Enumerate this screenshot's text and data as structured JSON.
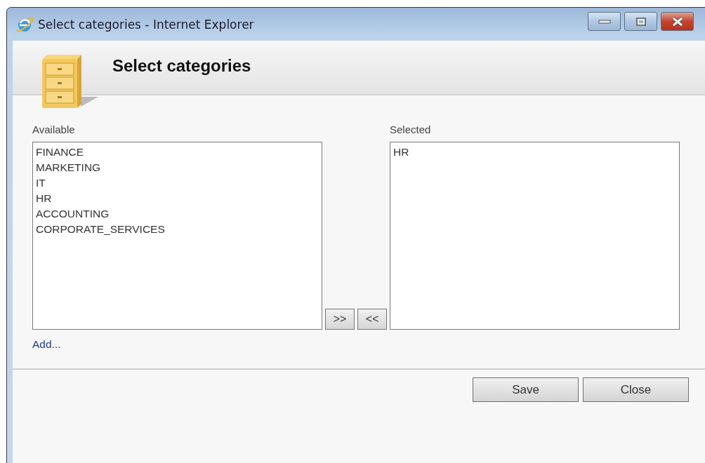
{
  "window": {
    "title": "Select categories - Internet Explorer"
  },
  "header": {
    "title": "Select categories"
  },
  "available": {
    "label": "Available",
    "items": [
      "FINANCE",
      "MARKETING",
      "IT",
      "HR",
      "ACCOUNTING",
      "CORPORATE_SERVICES"
    ]
  },
  "move_buttons": [
    ">>",
    "<<"
  ],
  "selected": {
    "label": "Selected",
    "items": [
      "HR"
    ]
  },
  "add_link": "Add...",
  "buttons": [
    "Save",
    "Close"
  ]
}
